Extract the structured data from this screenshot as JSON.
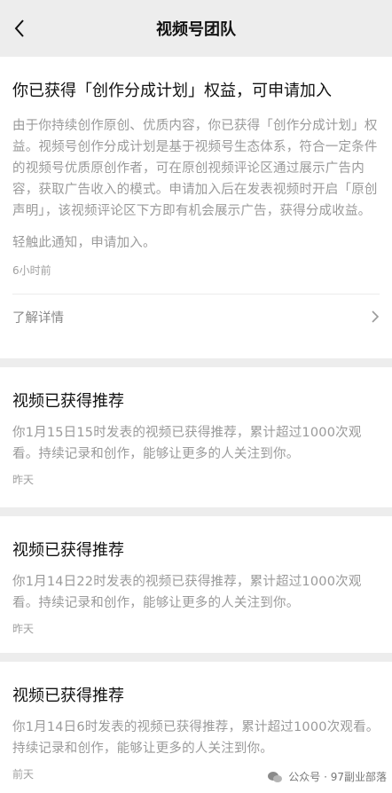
{
  "header": {
    "title": "视频号团队"
  },
  "cards": [
    {
      "title": "你已获得「创作分成计划」权益，可申请加入",
      "body": "由于你持续创作原创、优质内容，你已获得「创作分成计划」权益。视频号创作分成计划是基于视频号生态体系，符合一定条件的视频号优质原创作者，可在原创视频评论区通过展示广告内容，获取广告收入的模式。申请加入后在发表视频时开启「原创声明」，该视频评论区下方即有机会展示广告，获得分成收益。",
      "notify": "轻触此通知，申请加入。",
      "time": "6小时前",
      "more_label": "了解详情"
    },
    {
      "title": "视频已获得推荐",
      "body": "你1月15日15时发表的视频已获得推荐，累计超过1000次观看。持续记录和创作，能够让更多的人关注到你。",
      "time": "昨天"
    },
    {
      "title": "视频已获得推荐",
      "body": "你1月14日22时发表的视频已获得推荐，累计超过1000次观看。持续记录和创作，能够让更多的人关注到你。",
      "time": "昨天"
    },
    {
      "title": "视频已获得推荐",
      "body": "你1月14日6时发表的视频已获得推荐，累计超过1000次观看。持续记录和创作，能够让更多的人关注到你。",
      "time": "前天"
    }
  ],
  "watermark": {
    "text": "公众号 · 97副业部落",
    "icon": "wechat-icon"
  },
  "icons": {
    "back": "chevron-left-icon",
    "more": "chevron-right-icon"
  },
  "colors": {
    "background": "#ededed",
    "card": "#ffffff",
    "title": "#111111",
    "body": "#9a9a9a"
  }
}
